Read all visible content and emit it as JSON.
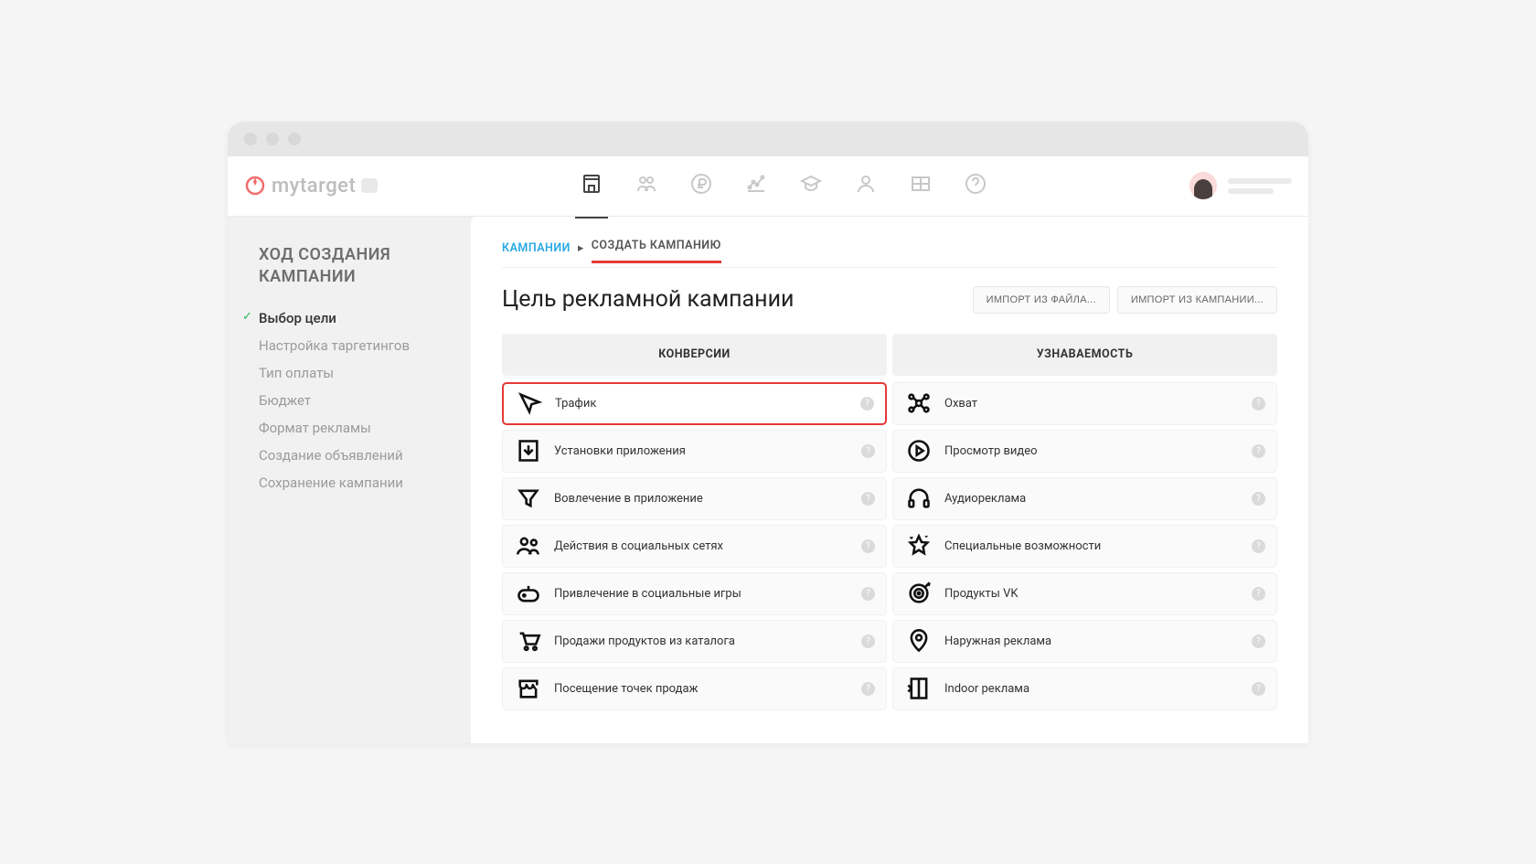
{
  "logo_text": "mytarget",
  "sidebar": {
    "title": "ХОД СОЗДАНИЯ КАМПАНИИ",
    "items": [
      {
        "label": "Выбор цели",
        "active": true
      },
      {
        "label": "Настройка таргетингов",
        "active": false
      },
      {
        "label": "Тип оплаты",
        "active": false
      },
      {
        "label": "Бюджет",
        "active": false
      },
      {
        "label": "Формат рекламы",
        "active": false
      },
      {
        "label": "Создание объявлений",
        "active": false
      },
      {
        "label": "Сохранение кампании",
        "active": false
      }
    ]
  },
  "breadcrumb": {
    "link": "КАМПАНИИ",
    "current": "СОЗДАТЬ КАМПАНИЮ"
  },
  "page_title": "Цель рекламной кампании",
  "actions": {
    "import_file": "ИМПОРТ ИЗ ФАЙЛА...",
    "import_campaign": "ИМПОРТ ИЗ КАМПАНИИ..."
  },
  "columns": {
    "conversions": {
      "header": "КОНВЕРСИИ",
      "items": [
        {
          "label": "Трафик",
          "icon": "cursor",
          "selected": true
        },
        {
          "label": "Установки приложения",
          "icon": "download",
          "selected": false
        },
        {
          "label": "Вовлечение в приложение",
          "icon": "funnel",
          "selected": false
        },
        {
          "label": "Действия в социальных сетях",
          "icon": "people",
          "selected": false
        },
        {
          "label": "Привлечение в социальные игры",
          "icon": "gamepad",
          "selected": false
        },
        {
          "label": "Продажи продуктов из каталога",
          "icon": "cart",
          "selected": false
        },
        {
          "label": "Посещение точек продаж",
          "icon": "store",
          "selected": false
        }
      ]
    },
    "awareness": {
      "header": "УЗНАВАЕМОСТЬ",
      "items": [
        {
          "label": "Охват",
          "icon": "network",
          "selected": false
        },
        {
          "label": "Просмотр видео",
          "icon": "play",
          "selected": false
        },
        {
          "label": "Аудиореклама",
          "icon": "headphones",
          "selected": false
        },
        {
          "label": "Специальные возможности",
          "icon": "star",
          "selected": false
        },
        {
          "label": "Продукты VK",
          "icon": "target",
          "selected": false
        },
        {
          "label": "Наружная реклама",
          "icon": "pin",
          "selected": false
        },
        {
          "label": "Indoor реклама",
          "icon": "door",
          "selected": false
        }
      ]
    }
  }
}
